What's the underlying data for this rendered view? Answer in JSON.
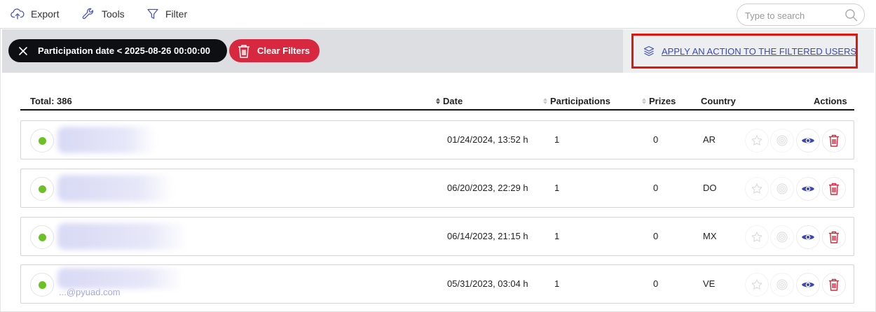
{
  "toolbar": {
    "export_label": "Export",
    "tools_label": "Tools",
    "filter_label": "Filter",
    "search_placeholder": "Type to search"
  },
  "filters": {
    "active_filter": "Participation date < 2025-08-26 00:00:00",
    "clear_label": "Clear Filters",
    "apply_action_label": "APPLY AN ACTION TO THE FILTERED USERS"
  },
  "table": {
    "total_label": "Total: 386",
    "columns": {
      "date": "Date",
      "participations": "Participations",
      "prizes": "Prizes",
      "country": "Country",
      "actions": "Actions"
    },
    "rows": [
      {
        "status": "active",
        "email": "",
        "date": "01/24/2024, 13:52 h",
        "participations": "1",
        "prizes": "0",
        "country": "AR"
      },
      {
        "status": "active",
        "email": "",
        "date": "06/20/2023, 22:29 h",
        "participations": "1",
        "prizes": "0",
        "country": "DO"
      },
      {
        "status": "active",
        "email": "",
        "date": "06/14/2023, 21:15 h",
        "participations": "1",
        "prizes": "0",
        "country": "MX"
      },
      {
        "status": "active",
        "email": "...@pyuad.com",
        "date": "05/31/2023, 03:04 h",
        "participations": "1",
        "prizes": "0",
        "country": "VE"
      }
    ]
  },
  "icons": {
    "export": "cloud-upload-icon",
    "tools": "wrench-icon",
    "filter": "funnel-icon",
    "search": "magnifier-icon",
    "close": "close-icon",
    "trash": "trash-icon",
    "layers": "layers-icon",
    "star": "star-icon",
    "target": "target-icon",
    "view": "eye-icon",
    "delete": "trash-icon"
  },
  "colors": {
    "chip_bg": "#0e0f13",
    "clear_bg": "#d8283f",
    "link": "#3d49b8",
    "status_active": "#6cc224",
    "highlight_box": "#e3150f",
    "view_icon": "#3a47b5",
    "delete_icon": "#d8283f"
  }
}
